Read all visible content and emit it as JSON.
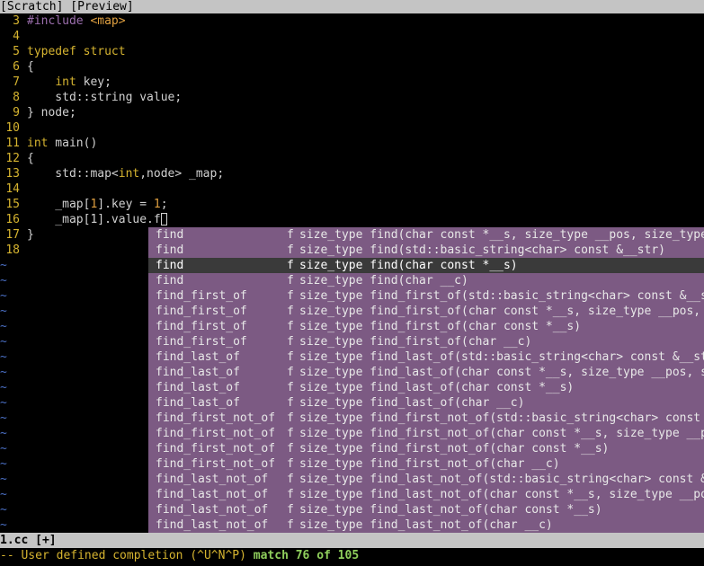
{
  "topbar": {
    "text": "[Scratch] [Preview]"
  },
  "editor": {
    "lines": [
      {
        "num": "3",
        "segments": [
          {
            "text": "#include ",
            "color": "#9c6fae"
          },
          {
            "text": "<map>",
            "color": "#e0a040"
          }
        ]
      },
      {
        "num": "4",
        "segments": []
      },
      {
        "num": "5",
        "segments": [
          {
            "text": "typedef struct",
            "color": "#d6b430"
          }
        ]
      },
      {
        "num": "6",
        "segments": [
          {
            "text": "{",
            "color": "#d0d0d0"
          }
        ]
      },
      {
        "num": "7",
        "segments": [
          {
            "text": "    ",
            "color": "#d0d0d0"
          },
          {
            "text": "int",
            "color": "#d6b430"
          },
          {
            "text": " key;",
            "color": "#d0d0d0"
          }
        ]
      },
      {
        "num": "8",
        "segments": [
          {
            "text": "    std::string value;",
            "color": "#d0d0d0"
          }
        ]
      },
      {
        "num": "9",
        "segments": [
          {
            "text": "} node;",
            "color": "#d0d0d0"
          }
        ]
      },
      {
        "num": "10",
        "segments": []
      },
      {
        "num": "11",
        "segments": [
          {
            "text": "int",
            "color": "#d6b430"
          },
          {
            "text": " main()",
            "color": "#d0d0d0"
          }
        ]
      },
      {
        "num": "12",
        "segments": [
          {
            "text": "{",
            "color": "#d0d0d0"
          }
        ]
      },
      {
        "num": "13",
        "segments": [
          {
            "text": "    std::map<",
            "color": "#d0d0d0"
          },
          {
            "text": "int",
            "color": "#d6b430"
          },
          {
            "text": ",node> _map;",
            "color": "#d0d0d0"
          }
        ]
      },
      {
        "num": "14",
        "segments": []
      },
      {
        "num": "15",
        "segments": [
          {
            "text": "    _map[",
            "color": "#d0d0d0"
          },
          {
            "text": "1",
            "color": "#e0a040"
          },
          {
            "text": "].key = ",
            "color": "#d0d0d0"
          },
          {
            "text": "1",
            "color": "#e0a040"
          },
          {
            "text": ";",
            "color": "#d0d0d0"
          }
        ]
      },
      {
        "num": "16",
        "segments": [
          {
            "text": "    _map[1].value.f",
            "color": "#d0d0d0"
          }
        ],
        "cursor": true
      },
      {
        "num": "17",
        "segments": [
          {
            "text": "}",
            "color": "#d0d0d0"
          }
        ]
      },
      {
        "num": "18",
        "segments": []
      }
    ],
    "tilde_char": "~",
    "tilde_count": 18
  },
  "completion": {
    "items": [
      {
        "word": "find",
        "kind": "f",
        "menu": "size_type find(char const *__s, size_type __pos, size_type __n)"
      },
      {
        "word": "find",
        "kind": "f",
        "menu": "size_type find(std::basic_string<char> const &__str)"
      },
      {
        "word": "find",
        "kind": "f",
        "menu": "size_type find(char const *__s)",
        "selected": true
      },
      {
        "word": "find",
        "kind": "f",
        "menu": "size_type find(char __c)"
      },
      {
        "word": "find_first_of",
        "kind": "f",
        "menu": "size_type find_first_of(std::basic_string<char> const &__str)"
      },
      {
        "word": "find_first_of",
        "kind": "f",
        "menu": "size_type find_first_of(char const *__s, size_type __pos, size_type __n)"
      },
      {
        "word": "find_first_of",
        "kind": "f",
        "menu": "size_type find_first_of(char const *__s)"
      },
      {
        "word": "find_first_of",
        "kind": "f",
        "menu": "size_type find_first_of(char __c)"
      },
      {
        "word": "find_last_of",
        "kind": "f",
        "menu": "size_type find_last_of(std::basic_string<char> const &__str)"
      },
      {
        "word": "find_last_of",
        "kind": "f",
        "menu": "size_type find_last_of(char const *__s, size_type __pos, size_type __n)"
      },
      {
        "word": "find_last_of",
        "kind": "f",
        "menu": "size_type find_last_of(char const *__s)"
      },
      {
        "word": "find_last_of",
        "kind": "f",
        "menu": "size_type find_last_of(char __c)"
      },
      {
        "word": "find_first_not_of",
        "kind": "f",
        "menu": "size_type find_first_not_of(std::basic_string<char> const &__str)"
      },
      {
        "word": "find_first_not_of",
        "kind": "f",
        "menu": "size_type find_first_not_of(char const *__s, size_type __pos, size_type __n)"
      },
      {
        "word": "find_first_not_of",
        "kind": "f",
        "menu": "size_type find_first_not_of(char const *__s)"
      },
      {
        "word": "find_first_not_of",
        "kind": "f",
        "menu": "size_type find_first_not_of(char __c)"
      },
      {
        "word": "find_last_not_of",
        "kind": "f",
        "menu": "size_type find_last_not_of(std::basic_string<char> const &__str)"
      },
      {
        "word": "find_last_not_of",
        "kind": "f",
        "menu": "size_type find_last_not_of(char const *__s, size_type __pos, size_type __n)"
      },
      {
        "word": "find_last_not_of",
        "kind": "f",
        "menu": "size_type find_last_not_of(char const *__s)"
      },
      {
        "word": "find_last_not_of",
        "kind": "f",
        "menu": "size_type find_last_not_of(char __c)"
      }
    ]
  },
  "status": {
    "text": "1.cc [+]"
  },
  "cmdline": {
    "mode_text": "-- User defined completion (^U^N^P) ",
    "match_text": "match 76 of 105"
  },
  "colors": {
    "line_number": "#d6b430",
    "keyword": "#d6b430",
    "preproc": "#9c6fae",
    "number": "#e0a040",
    "tilde": "#4a6fc4",
    "popup_bg": "#7c5a83",
    "popup_sel_bg": "#3a3a3a",
    "statusbar_bg": "#c4c4c4"
  }
}
